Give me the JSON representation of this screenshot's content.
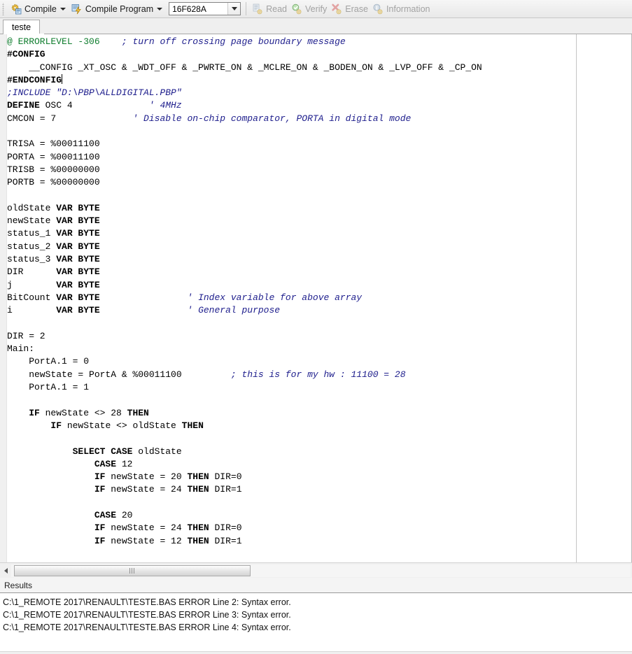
{
  "toolbar": {
    "grip_icon": "drag-grip",
    "items": [
      {
        "id": "compile",
        "label": "Compile",
        "icon": "compile-gear-icon",
        "caret": true,
        "disabled": false
      },
      {
        "id": "compile-program",
        "label": "Compile Program",
        "icon": "compile-program-lightning-icon",
        "caret": true,
        "disabled": false
      }
    ],
    "device_combo": {
      "value": "16F628A",
      "placeholder": "16F628A",
      "caret_icon": "chevron-down-icon"
    },
    "prog_items": [
      {
        "id": "read",
        "label": "Read",
        "icon": "read-document-icon",
        "disabled": true
      },
      {
        "id": "verify",
        "label": "Verify",
        "icon": "verify-check-icon",
        "disabled": true
      },
      {
        "id": "erase",
        "label": "Erase",
        "icon": "erase-x-icon",
        "disabled": true
      },
      {
        "id": "information",
        "label": "Information",
        "icon": "information-icon",
        "disabled": true
      }
    ]
  },
  "tabs": [
    {
      "id": "teste",
      "label": "teste",
      "active": true
    }
  ],
  "editor": {
    "caret_visible": true,
    "colors": {
      "keyword": "#000000",
      "comment": "#1d1d8c",
      "directive": "#0f7d2e",
      "background": "#ffffff",
      "margin_guide": "#c4c4c4"
    },
    "lines": [
      [
        {
          "t": "@ ERRORLEVEL -306",
          "s": "gcmt"
        },
        {
          "t": "    ",
          "s": "p"
        },
        {
          "t": "; turn off crossing page boundary message",
          "s": "cmt"
        }
      ],
      [
        {
          "t": "#CONFIG",
          "s": "kw"
        }
      ],
      [
        {
          "t": "    __CONFIG _XT_OSC & _WDT_OFF & _PWRTE_ON & _MCLRE_ON & _BODEN_ON & _LVP_OFF & _CP_ON",
          "s": "p"
        }
      ],
      [
        {
          "t": "#ENDCONFIG",
          "s": "kw"
        },
        {
          "t": "",
          "s": "caret"
        }
      ],
      [
        {
          "t": ";INCLUDE \"D:\\PBP\\ALLDIGITAL.PBP\"",
          "s": "cmt"
        }
      ],
      [
        {
          "t": "DEFINE",
          "s": "kw"
        },
        {
          "t": " OSC 4              ",
          "s": "p"
        },
        {
          "t": "' 4MHz",
          "s": "cmt"
        }
      ],
      [
        {
          "t": "CMCON = 7              ",
          "s": "p"
        },
        {
          "t": "' Disable on-chip comparator, PORTA in digital mode",
          "s": "cmt"
        }
      ],
      [
        {
          "t": "",
          "s": "p"
        }
      ],
      [
        {
          "t": "TRISA = %00011100",
          "s": "p"
        }
      ],
      [
        {
          "t": "PORTA = %00011100",
          "s": "p"
        }
      ],
      [
        {
          "t": "TRISB = %00000000",
          "s": "p"
        }
      ],
      [
        {
          "t": "PORTB = %00000000",
          "s": "p"
        }
      ],
      [
        {
          "t": "",
          "s": "p"
        }
      ],
      [
        {
          "t": "oldState ",
          "s": "p"
        },
        {
          "t": "VAR BYTE",
          "s": "kw"
        }
      ],
      [
        {
          "t": "newState ",
          "s": "p"
        },
        {
          "t": "VAR BYTE",
          "s": "kw"
        }
      ],
      [
        {
          "t": "status_1 ",
          "s": "p"
        },
        {
          "t": "VAR BYTE",
          "s": "kw"
        }
      ],
      [
        {
          "t": "status_2 ",
          "s": "p"
        },
        {
          "t": "VAR BYTE",
          "s": "kw"
        }
      ],
      [
        {
          "t": "status_3 ",
          "s": "p"
        },
        {
          "t": "VAR BYTE",
          "s": "kw"
        }
      ],
      [
        {
          "t": "DIR      ",
          "s": "p"
        },
        {
          "t": "VAR BYTE",
          "s": "kw"
        }
      ],
      [
        {
          "t": "j        ",
          "s": "p"
        },
        {
          "t": "VAR BYTE",
          "s": "kw"
        }
      ],
      [
        {
          "t": "BitCount ",
          "s": "p"
        },
        {
          "t": "VAR BYTE",
          "s": "kw"
        },
        {
          "t": "                ",
          "s": "p"
        },
        {
          "t": "' Index variable for above array",
          "s": "cmt"
        }
      ],
      [
        {
          "t": "i        ",
          "s": "p"
        },
        {
          "t": "VAR BYTE",
          "s": "kw"
        },
        {
          "t": "                ",
          "s": "p"
        },
        {
          "t": "' General purpose",
          "s": "cmt"
        }
      ],
      [
        {
          "t": "",
          "s": "p"
        }
      ],
      [
        {
          "t": "DIR = 2",
          "s": "p"
        }
      ],
      [
        {
          "t": "Main:",
          "s": "p"
        }
      ],
      [
        {
          "t": "    PortA.1 = 0",
          "s": "p"
        }
      ],
      [
        {
          "t": "    newState = PortA & %00011100",
          "s": "p"
        },
        {
          "t": "         ",
          "s": "p"
        },
        {
          "t": "; this is for my hw : 11100 = 28",
          "s": "cmt"
        }
      ],
      [
        {
          "t": "    PortA.1 = 1",
          "s": "p"
        }
      ],
      [
        {
          "t": "",
          "s": "p"
        }
      ],
      [
        {
          "t": "    ",
          "s": "p"
        },
        {
          "t": "IF",
          "s": "kw"
        },
        {
          "t": " newState <> 28 ",
          "s": "p"
        },
        {
          "t": "THEN",
          "s": "kw"
        }
      ],
      [
        {
          "t": "        ",
          "s": "p"
        },
        {
          "t": "IF",
          "s": "kw"
        },
        {
          "t": " newState <> oldState ",
          "s": "p"
        },
        {
          "t": "THEN",
          "s": "kw"
        }
      ],
      [
        {
          "t": "",
          "s": "p"
        }
      ],
      [
        {
          "t": "            ",
          "s": "p"
        },
        {
          "t": "SELECT CASE",
          "s": "kw"
        },
        {
          "t": " oldState",
          "s": "p"
        }
      ],
      [
        {
          "t": "                ",
          "s": "p"
        },
        {
          "t": "CASE",
          "s": "kw"
        },
        {
          "t": " 12",
          "s": "p"
        }
      ],
      [
        {
          "t": "                ",
          "s": "p"
        },
        {
          "t": "IF",
          "s": "kw"
        },
        {
          "t": " newState = 20 ",
          "s": "p"
        },
        {
          "t": "THEN",
          "s": "kw"
        },
        {
          "t": " DIR=0",
          "s": "p"
        }
      ],
      [
        {
          "t": "                ",
          "s": "p"
        },
        {
          "t": "IF",
          "s": "kw"
        },
        {
          "t": " newState = 24 ",
          "s": "p"
        },
        {
          "t": "THEN",
          "s": "kw"
        },
        {
          "t": " DIR=1",
          "s": "p"
        }
      ],
      [
        {
          "t": "",
          "s": "p"
        }
      ],
      [
        {
          "t": "                ",
          "s": "p"
        },
        {
          "t": "CASE",
          "s": "kw"
        },
        {
          "t": " 20",
          "s": "p"
        }
      ],
      [
        {
          "t": "                ",
          "s": "p"
        },
        {
          "t": "IF",
          "s": "kw"
        },
        {
          "t": " newState = 24 ",
          "s": "p"
        },
        {
          "t": "THEN",
          "s": "kw"
        },
        {
          "t": " DIR=0",
          "s": "p"
        }
      ],
      [
        {
          "t": "                ",
          "s": "p"
        },
        {
          "t": "IF",
          "s": "kw"
        },
        {
          "t": " newState = 12 ",
          "s": "p"
        },
        {
          "t": "THEN",
          "s": "kw"
        },
        {
          "t": " DIR=1",
          "s": "p"
        }
      ]
    ]
  },
  "hscrollbar": {
    "left_arrow_icon": "chevron-left-icon",
    "thumb_grip_icon": "scroll-grip-icon"
  },
  "results": {
    "title": "Results",
    "lines": [
      "C:\\1_REMOTE 2017\\RENAULT\\TESTE.BAS ERROR Line 2: Syntax error.",
      "C:\\1_REMOTE 2017\\RENAULT\\TESTE.BAS ERROR Line 3: Syntax error.",
      "C:\\1_REMOTE 2017\\RENAULT\\TESTE.BAS ERROR Line 4: Syntax error."
    ]
  }
}
